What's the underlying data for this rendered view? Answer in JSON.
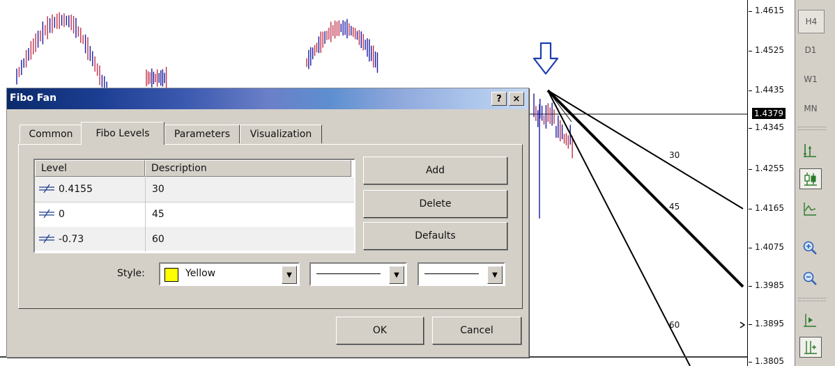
{
  "price_axis": {
    "ticks": [
      "1.4615",
      "1.4525",
      "1.4435",
      "1.4345",
      "1.4255",
      "1.4165",
      "1.4075",
      "1.3985",
      "1.3895",
      "1.3805"
    ],
    "current_price": "1.4379"
  },
  "timeframes": [
    "H4",
    "D1",
    "W1",
    "MN"
  ],
  "active_timeframe": "H4",
  "toolbar_icons": [
    "bar-chart-icon",
    "candlestick-icon",
    "line-chart-icon",
    "zoom-in-icon",
    "zoom-out-icon",
    "auto-scroll-icon",
    "chart-shift-icon"
  ],
  "fan_labels": [
    "30",
    "45",
    "60"
  ],
  "colors": {
    "bull_bar": "#1a1aa0",
    "bear_bar": "#c0304a",
    "fan_line": "#000000",
    "arrow": "#1a3cae",
    "swatch": "#ffff00"
  },
  "dialog": {
    "title": "Fibo Fan",
    "help_label": "?",
    "close_label": "×",
    "tabs": [
      "Common",
      "Fibo Levels",
      "Parameters",
      "Visualization"
    ],
    "active_tab": "Fibo Levels",
    "table": {
      "headers": [
        "Level",
        "Description"
      ],
      "rows": [
        {
          "level": "0.4155",
          "description": "30"
        },
        {
          "level": "0",
          "description": "45"
        },
        {
          "level": "-0.73",
          "description": "60"
        }
      ]
    },
    "buttons": {
      "add": "Add",
      "delete": "Delete",
      "defaults": "Defaults",
      "ok": "OK",
      "cancel": "Cancel"
    },
    "style_label": "Style:",
    "color_value": "Yellow"
  }
}
